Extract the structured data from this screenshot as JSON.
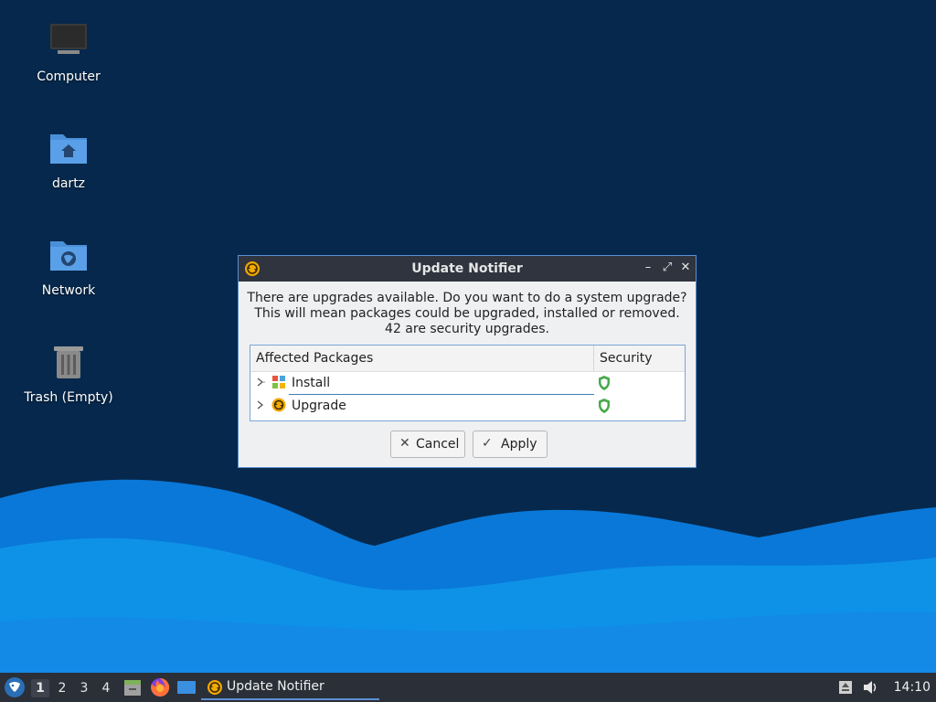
{
  "desktop": {
    "icons": [
      {
        "label": "Computer",
        "icon": "computer-icon"
      },
      {
        "label": "dartz",
        "icon": "home-folder-icon"
      },
      {
        "label": "Network",
        "icon": "network-folder-icon"
      },
      {
        "label": "Trash (Empty)",
        "icon": "trash-icon"
      }
    ],
    "colors": {
      "background": "#06284c",
      "wave_light": "#0fa0f0",
      "wave_mid": "#0a78d8"
    }
  },
  "dialog": {
    "title": "Update Notifier",
    "app_icon": "update-notifier-icon",
    "window_buttons": {
      "minimize": "–",
      "maximize": "⤢",
      "close": "✕"
    },
    "message": {
      "line1": "There are upgrades available. Do you want to do a system upgrade?",
      "line2": "This will mean packages could be upgraded, installed or removed.",
      "line3": "42 are security upgrades."
    },
    "tree": {
      "columns": {
        "packages": "Affected Packages",
        "security": "Security"
      },
      "rows": [
        {
          "label": "Install",
          "icon": "install-package-icon",
          "security_icon": "shield-icon"
        },
        {
          "label": "Upgrade",
          "icon": "upgrade-package-icon",
          "security_icon": "shield-icon"
        }
      ]
    },
    "buttons": {
      "cancel": "Cancel",
      "apply": "Apply"
    },
    "icons": {
      "cancel": "✕",
      "apply": "✓"
    }
  },
  "taskbar": {
    "workspaces": [
      "1",
      "2",
      "3",
      "4"
    ],
    "active_workspace": "1",
    "launchers": [
      "whisker-menu-icon",
      "file-manager-icon",
      "firefox-icon",
      "desktop-icon"
    ],
    "task": {
      "label": "Update Notifier",
      "icon": "update-notifier-icon"
    },
    "tray": [
      "removable-drive-icon",
      "volume-icon"
    ],
    "clock": "14:10"
  }
}
